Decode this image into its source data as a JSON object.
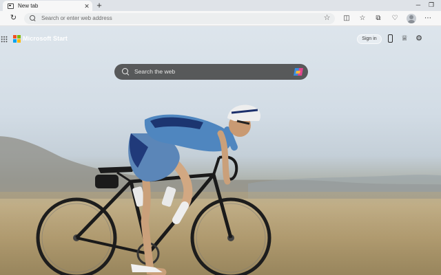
{
  "browser": {
    "tab": {
      "title": "New tab",
      "close": "✕"
    },
    "new_tab": "+",
    "window": {
      "minimize": "─",
      "restore": "❐"
    },
    "address_bar": {
      "placeholder": "Search or enter web address"
    }
  },
  "page": {
    "brand": "Microsoft Start",
    "signin_label": "Sign in",
    "search": {
      "placeholder": "Search the web"
    }
  },
  "icons": {
    "refresh": "↻",
    "favorite": "☆",
    "split": "◫",
    "favorites": "☆",
    "collections": "⧉",
    "extensions": "♡",
    "more": "⋯",
    "rewards": "♕",
    "settings": "⚙"
  },
  "colors": {
    "ms_red": "#f25022",
    "ms_green": "#7fba00",
    "ms_blue": "#00a4ef",
    "ms_yellow": "#ffb900"
  }
}
